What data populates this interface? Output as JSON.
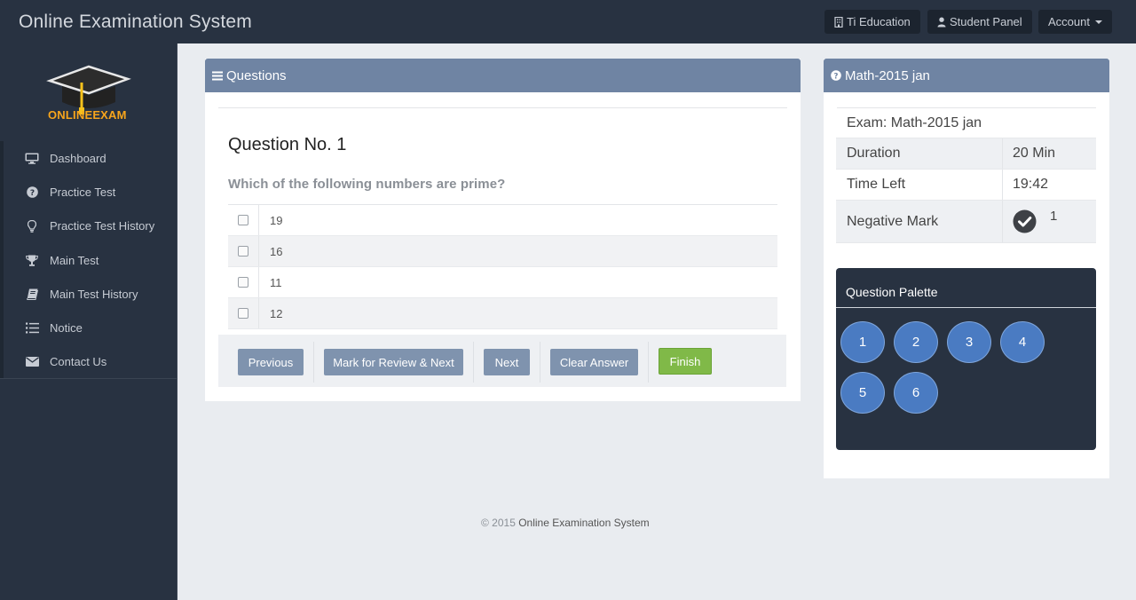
{
  "app": {
    "title": "Online Examination System"
  },
  "topbar": {
    "org_label": "Ti Education",
    "panel_label": "Student Panel",
    "account_label": "Account"
  },
  "sidebar": {
    "logo": {
      "part1": "ONLINE",
      "part2": "EXAM"
    },
    "items": [
      {
        "label": "Dashboard",
        "icon": "monitor-icon"
      },
      {
        "label": "Practice Test",
        "icon": "question-circle-icon"
      },
      {
        "label": "Practice Test History",
        "icon": "lightbulb-icon"
      },
      {
        "label": "Main Test",
        "icon": "trophy-icon"
      },
      {
        "label": "Main Test History",
        "icon": "book-icon"
      },
      {
        "label": "Notice",
        "icon": "list-icon"
      },
      {
        "label": "Contact Us",
        "icon": "envelope-icon"
      }
    ]
  },
  "questions_panel": {
    "title": "Questions",
    "question_number": "Question No. 1",
    "question_text": "Which of the following numbers are prime?",
    "options": [
      "19",
      "16",
      "11",
      "12"
    ],
    "buttons": {
      "previous": "Previous",
      "mark_review": "Mark for Review & Next",
      "next": "Next",
      "clear": "Clear Answer",
      "finish": "Finish"
    }
  },
  "exam_panel": {
    "title": "Math-2015 jan",
    "exam_label": "Exam: Math-2015 jan",
    "rows": [
      {
        "label": "Duration",
        "value": "20 Min"
      },
      {
        "label": "Time Left",
        "value": "19:42"
      },
      {
        "label": "Negative Mark",
        "value": "1"
      }
    ],
    "palette_title": "Question Palette",
    "palette_numbers": [
      "1",
      "2",
      "3",
      "4",
      "5",
      "6"
    ]
  },
  "footer": {
    "prefix": "© 2015",
    "name": "Online Examination System"
  },
  "colors": {
    "topbar": "#283241",
    "panel_header": "#6f84a3",
    "button_gray": "#7f93ae",
    "button_finish": "#80b948",
    "palette_bubble": "#4a7bc2"
  }
}
